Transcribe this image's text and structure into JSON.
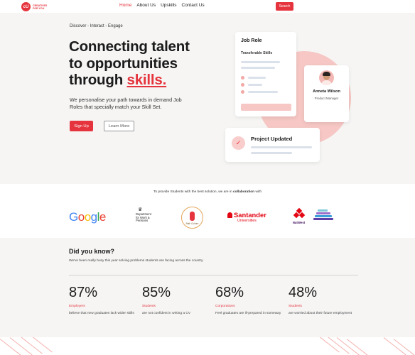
{
  "nav": {
    "logo_mark": "cU",
    "logo_line1": "CREATIVES",
    "logo_line2": "FOR YOU",
    "links": [
      "Home",
      "About Us",
      "Upskills",
      "Contact Us"
    ],
    "active_link": "Home",
    "search_button": "Search"
  },
  "hero": {
    "tagline": "Discover - Interact - Engage",
    "headline_line1": "Connecting talent",
    "headline_line2": "to opportunities",
    "headline_line3_prefix": "through ",
    "headline_highlight": "skills.",
    "subtitle": "We personalise your path towards in demand Job Roles that specially match your Skill Set.",
    "signup_button": "Sign Up",
    "learn_more_button": "Learn More",
    "job_card_title": "Job Role",
    "job_card_subtitle": "Transferable Skills",
    "person_name": "Anneta Wilson",
    "person_role": "Product Manager",
    "project_title": "Project Updated",
    "colors": {
      "accent": "#e5343d",
      "accent_light": "#f6c7c4",
      "hero_bg": "#f6f5f4"
    }
  },
  "partners": {
    "intro_prefix": "To provide Students with the best solution, we are in ",
    "intro_bold": "collaboration",
    "intro_suffix": " with",
    "google": "Google",
    "dwp_line1": "Department",
    "dwp_line2": "for Work &",
    "dwp_line3": "Pensions",
    "bath": "Bath Culture",
    "santander_name": "Santander",
    "santander_sub": "Universities",
    "natwest": "NatWest"
  },
  "stats": {
    "title": "Did you know?",
    "subtitle": "We've been really busy this year solving problems students are facing across the country.",
    "items": [
      {
        "value": "87%",
        "category": "Employers",
        "description": "believe that new graduates lack wider skills"
      },
      {
        "value": "85%",
        "category": "Students",
        "description": "are not confident in writing a CV"
      },
      {
        "value": "68%",
        "category": "Corporations",
        "description": "Feel graduates are ill-prepared in someway"
      },
      {
        "value": "48%",
        "category": "Students",
        "description": "are worried about their future employment"
      }
    ]
  }
}
